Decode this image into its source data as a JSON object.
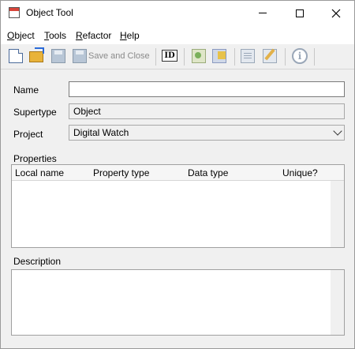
{
  "window": {
    "title": "Object Tool",
    "controls": [
      "minimize",
      "maximize",
      "close"
    ]
  },
  "menu": {
    "items": [
      "Object",
      "Tools",
      "Refactor",
      "Help"
    ]
  },
  "toolbar": {
    "save_and_close_label": "Save and Close",
    "id_icon_text": "ID",
    "info_icon_text": "i",
    "icons": [
      "new-icon",
      "open-icon",
      "save-icon",
      "save-close-icon",
      "id-icon",
      "graph-icon",
      "graph-alt-icon",
      "document-icon",
      "edit-icon",
      "info-icon"
    ]
  },
  "form": {
    "name_label": "Name",
    "name_value": "",
    "supertype_label": "Supertype",
    "supertype_value": "Object",
    "project_label": "Project",
    "project_value": "Digital Watch",
    "properties_label": "Properties",
    "properties_columns": [
      "Local name",
      "Property type",
      "Data type",
      "Unique?"
    ],
    "properties_rows": [],
    "description_label": "Description",
    "description_value": ""
  }
}
